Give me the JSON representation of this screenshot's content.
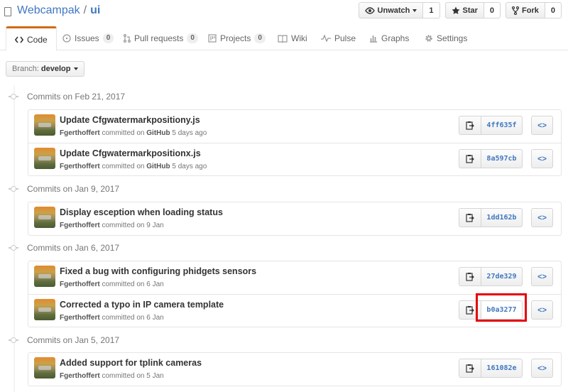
{
  "repo": {
    "owner": "Webcampak",
    "separator": "/",
    "name": "ui"
  },
  "actions": {
    "watch": {
      "label": "Unwatch",
      "count": "1"
    },
    "star": {
      "label": "Star",
      "count": "0"
    },
    "fork": {
      "label": "Fork",
      "count": "0"
    }
  },
  "tabs": [
    {
      "label": "Code",
      "icon": "code-icon",
      "counter": ""
    },
    {
      "label": "Issues",
      "icon": "issue-icon",
      "counter": "0"
    },
    {
      "label": "Pull requests",
      "icon": "pull-request-icon",
      "counter": "0"
    },
    {
      "label": "Projects",
      "icon": "project-icon",
      "counter": "0"
    },
    {
      "label": "Wiki",
      "icon": "wiki-icon",
      "counter": ""
    },
    {
      "label": "Pulse",
      "icon": "pulse-icon",
      "counter": ""
    },
    {
      "label": "Graphs",
      "icon": "graph-icon",
      "counter": ""
    },
    {
      "label": "Settings",
      "icon": "gear-icon",
      "counter": ""
    }
  ],
  "branch": {
    "label": "Branch:",
    "value": "develop"
  },
  "groups": [
    {
      "heading": "Commits on Feb 21, 2017",
      "commits": [
        {
          "message": "Update Cfgwatermarkpositiony.js",
          "author": "Fgerthoffert",
          "verb": "committed on",
          "via": "GitHub",
          "when": "5 days ago",
          "sha": "4ff635f"
        },
        {
          "message": "Update Cfgwatermarkpositionx.js",
          "author": "Fgerthoffert",
          "verb": "committed on",
          "via": "GitHub",
          "when": "5 days ago",
          "sha": "8a597cb"
        }
      ]
    },
    {
      "heading": "Commits on Jan 9, 2017",
      "commits": [
        {
          "message": "Display esception when loading status",
          "author": "Fgerthoffert",
          "verb": "committed on",
          "via": "",
          "when": "9 Jan",
          "sha": "1dd162b"
        }
      ]
    },
    {
      "heading": "Commits on Jan 6, 2017",
      "commits": [
        {
          "message": "Fixed a bug with configuring phidgets sensors",
          "author": "Fgerthoffert",
          "verb": "committed on",
          "via": "",
          "when": "6 Jan",
          "sha": "27de329"
        },
        {
          "message": "Corrected a typo in IP camera template",
          "author": "Fgerthoffert",
          "verb": "committed on",
          "via": "",
          "when": "6 Jan",
          "sha": "b0a3277",
          "highlighted": true
        }
      ]
    },
    {
      "heading": "Commits on Jan 5, 2017",
      "commits": [
        {
          "message": "Added support for tplink cameras",
          "author": "Fgerthoffert",
          "verb": "committed on",
          "via": "",
          "when": "5 Jan",
          "sha": "161082e"
        }
      ]
    }
  ],
  "tree_button_glyph": "<>",
  "colors": {
    "link": "#4078c0",
    "tab_accent": "#d26911",
    "highlight": "#e6000a"
  }
}
